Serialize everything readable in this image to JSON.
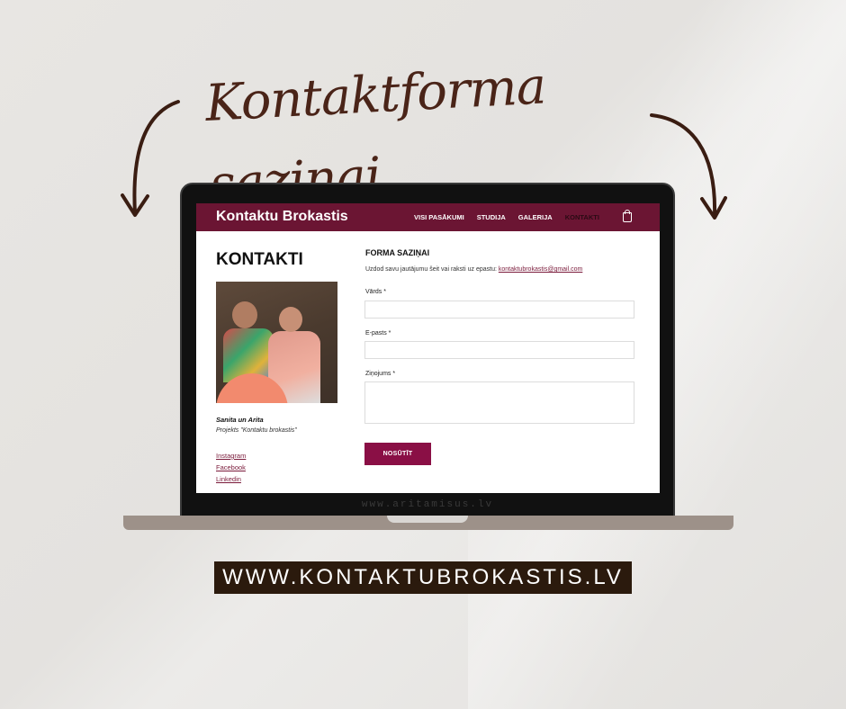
{
  "headline": "Kontaktforma saziņai",
  "site": {
    "logo": "Kontaktu Brokastis",
    "menu": [
      "VISI PASĀKUMI",
      "STUDIJA",
      "GALERIJA",
      "KONTAKTI"
    ],
    "active_menu": "KONTAKTI"
  },
  "page": {
    "title": "KONTAKTI",
    "names": "Sanita un Arita",
    "project": "Projekts \"Kontaktu brokastis\"",
    "links": [
      "Instagram",
      "Facebook",
      "Linkedin"
    ]
  },
  "form": {
    "title": "FORMA SAZIŅAI",
    "intro": "Uzdod savu jautājumu šeit vai raksti uz epastu:",
    "email": "kontaktubrokastis@gmail.com",
    "name_label": "Vārds *",
    "email_label": "E-pasts *",
    "message_label": "Ziņojums *",
    "submit_label": "NOSŪTĪT"
  },
  "watermark": "www.aritamisus.lv",
  "footer_url": "WWW.KONTAKTUBROKASTIS.LV",
  "colors": {
    "brand": "#6b1533",
    "button": "#8a0f45",
    "headline": "#4a2418",
    "url_box": "#2b1a0d"
  }
}
